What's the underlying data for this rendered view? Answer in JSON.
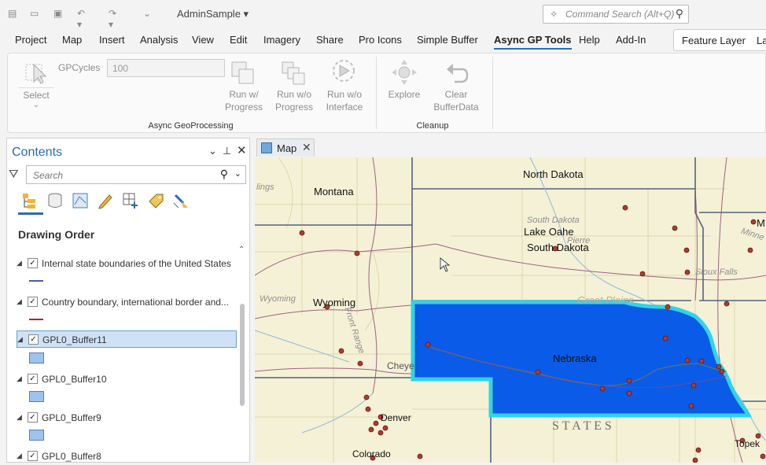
{
  "titlebar": {
    "app_title": "AdminSample ▾",
    "command_search_placeholder": "Command Search (Alt+Q)"
  },
  "menu": {
    "tabs": [
      "Project",
      "Map",
      "Insert",
      "Analysis",
      "View",
      "Edit",
      "Imagery",
      "Share",
      "Pro Icons",
      "Simple Buffer",
      "Async GP Tools",
      "Help",
      "Add-In"
    ],
    "active": "Async GP Tools",
    "contextual": [
      "Feature Layer",
      "La"
    ]
  },
  "ribbon": {
    "select_label": "Select",
    "gpcycles_label": "GPCycles",
    "gpcycles_value": "100",
    "run_progress": "Run w/\nProgress",
    "run_no_progress": "Run w/o\nProgress",
    "run_no_interface": "Run w/o\nInterface",
    "explore": "Explore",
    "clear_buffer": "Clear\nBufferData",
    "group_async": "Async GeoProcessing",
    "group_cleanup": "Cleanup"
  },
  "contents": {
    "title": "Contents",
    "search_placeholder": "Search",
    "drawing_order": "Drawing Order",
    "layers": [
      {
        "name": "Internal state boundaries of the United States",
        "checked": true,
        "symbol": "line",
        "color": "#4a5aa8"
      },
      {
        "name": "Country boundary, international border and...",
        "checked": true,
        "symbol": "line",
        "color": "#b02040"
      },
      {
        "name": "GPL0_Buffer11",
        "checked": true,
        "symbol": "fill",
        "selected": true
      },
      {
        "name": "GPL0_Buffer10",
        "checked": true,
        "symbol": "fill"
      },
      {
        "name": "GPL0_Buffer9",
        "checked": true,
        "symbol": "fill"
      },
      {
        "name": "GPL0_Buffer8",
        "checked": true,
        "symbol": "fill"
      }
    ]
  },
  "map": {
    "tab_label": "Map",
    "labels": {
      "north_dakota": "North Dakota",
      "montana": "Montana",
      "south_dakota_faint": "South Dakota",
      "lake_oahe": "Lake Oahe",
      "pierre": "Pierre",
      "south_dakota": "South Dakota",
      "wyoming_faint": "Wyoming",
      "wyoming": "Wyoming",
      "great_plains": "Great Plains",
      "sioux_falls": "Sioux Falls",
      "nebraska": "Nebraska",
      "cheye": "Cheye",
      "denver": "Denver",
      "states": "S T A T E S",
      "colorado": "Colorado",
      "topeka": "Topek",
      "minne": "Minne",
      "lings": "lings",
      "front_range": "Front Range",
      "m_edge": "M"
    },
    "colors": {
      "buffer_fill": "#0a5be8",
      "buffer_outline": "#2fd4e8",
      "land": "#f5f1d6"
    }
  }
}
